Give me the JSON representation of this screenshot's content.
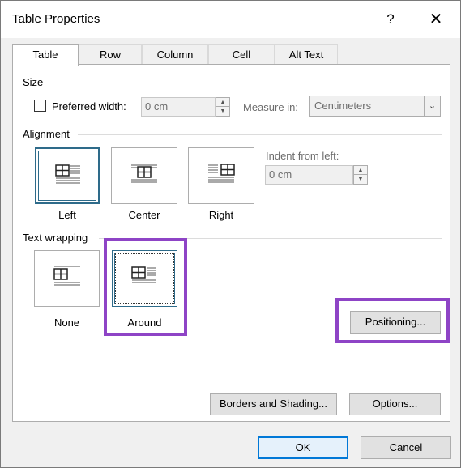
{
  "window": {
    "title": "Table Properties",
    "help": "?",
    "close": "✕"
  },
  "tabs": [
    {
      "label": "Table",
      "active": true
    },
    {
      "label": "Row",
      "active": false
    },
    {
      "label": "Column",
      "active": false
    },
    {
      "label": "Cell",
      "active": false
    },
    {
      "label": "Alt Text",
      "active": false
    }
  ],
  "size": {
    "label": "Size",
    "preferred_width_label": "Preferred width:",
    "preferred_width_checked": false,
    "width_value": "0 cm",
    "measure_in_label": "Measure in:",
    "measure_in_value": "Centimeters"
  },
  "alignment": {
    "label": "Alignment",
    "options": [
      "Left",
      "Center",
      "Right"
    ],
    "selected": "Left",
    "indent_label": "Indent from left:",
    "indent_value": "0 cm"
  },
  "text_wrapping": {
    "label": "Text wrapping",
    "options": [
      "None",
      "Around"
    ],
    "selected": "Around",
    "positioning_button": "Positioning..."
  },
  "buttons": {
    "borders": "Borders and Shading...",
    "options": "Options...",
    "ok": "OK",
    "cancel": "Cancel"
  },
  "annotation_color": "#8e44c6",
  "selection_color": "#2e6b8a"
}
